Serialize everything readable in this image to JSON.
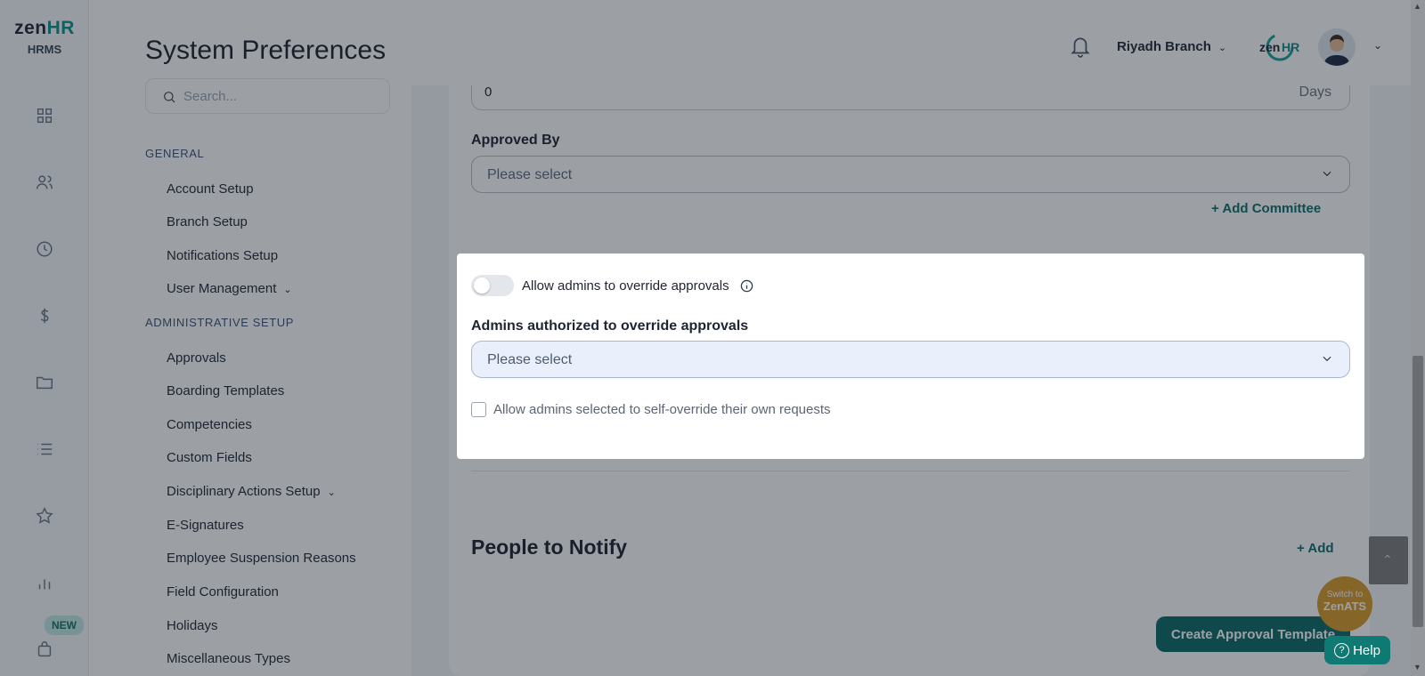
{
  "brand": {
    "name_part1": "zen",
    "name_part2": "HR",
    "subtitle": "HRMS"
  },
  "rail": {
    "icons": [
      "dashboard-icon",
      "people-icon",
      "clock-icon",
      "dollar-icon",
      "folder-icon",
      "list-icon",
      "star-icon",
      "bar-chart-icon",
      "bag-icon"
    ],
    "new_badge": "NEW"
  },
  "sidebar": {
    "title": "System Preferences",
    "search_placeholder": "Search...",
    "sections": [
      {
        "label": "GENERAL",
        "items": [
          "Account Setup",
          "Branch Setup",
          "Notifications Setup",
          "User Management"
        ]
      },
      {
        "label": "ADMINISTRATIVE SETUP",
        "items": [
          "Approvals",
          "Boarding Templates",
          "Competencies",
          "Custom Fields",
          "Disciplinary Actions Setup",
          "E-Signatures",
          "Employee Suspension Reasons",
          "Field Configuration",
          "Holidays",
          "Miscellaneous Types"
        ]
      }
    ]
  },
  "header": {
    "branch": "Riyadh Branch",
    "logo_text_1": "zen",
    "logo_text_2": "HR"
  },
  "main": {
    "days_field": {
      "value": "0",
      "unit": "Days"
    },
    "approved_by": {
      "label": "Approved By",
      "placeholder": "Please select"
    },
    "add_committee": "+ Add Committee",
    "override_card": {
      "toggle_label": "Allow admins to override approvals",
      "toggle_on": false,
      "admins_label": "Admins authorized to override approvals",
      "admins_placeholder": "Please select",
      "self_override_label": "Allow admins selected to self-override their own requests",
      "self_override_checked": false
    },
    "people_to_notify": {
      "title": "People to Notify",
      "add_label": "+ Add"
    },
    "create_button": "Create Approval Template"
  },
  "widgets": {
    "switch_line1": "Switch to",
    "switch_line2": "ZenATS",
    "help": "Help"
  },
  "colors": {
    "accent": "#0f6a66",
    "brand_teal": "#0e8f8a",
    "switch_orange": "#d99a2a"
  }
}
